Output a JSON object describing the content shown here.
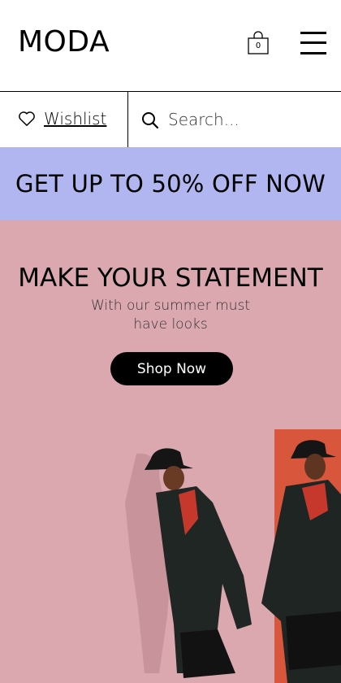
{
  "header": {
    "logo": "MODA",
    "cart_count": "0",
    "cart_icon": "shopping-bag-icon",
    "menu_icon": "hamburger-menu-icon"
  },
  "utility": {
    "wishlist_label": "Wishlist",
    "wishlist_icon": "heart-icon",
    "search_placeholder": "Search...",
    "search_icon": "search-icon"
  },
  "promo": {
    "text": "GET UP TO 50% OFF NOW",
    "background": "#b1b6f1"
  },
  "hero": {
    "title": "MAKE YOUR STATEMENT",
    "subtitle": "With our summer must have looks",
    "button_label": "Shop Now",
    "background": "#dba8af"
  }
}
